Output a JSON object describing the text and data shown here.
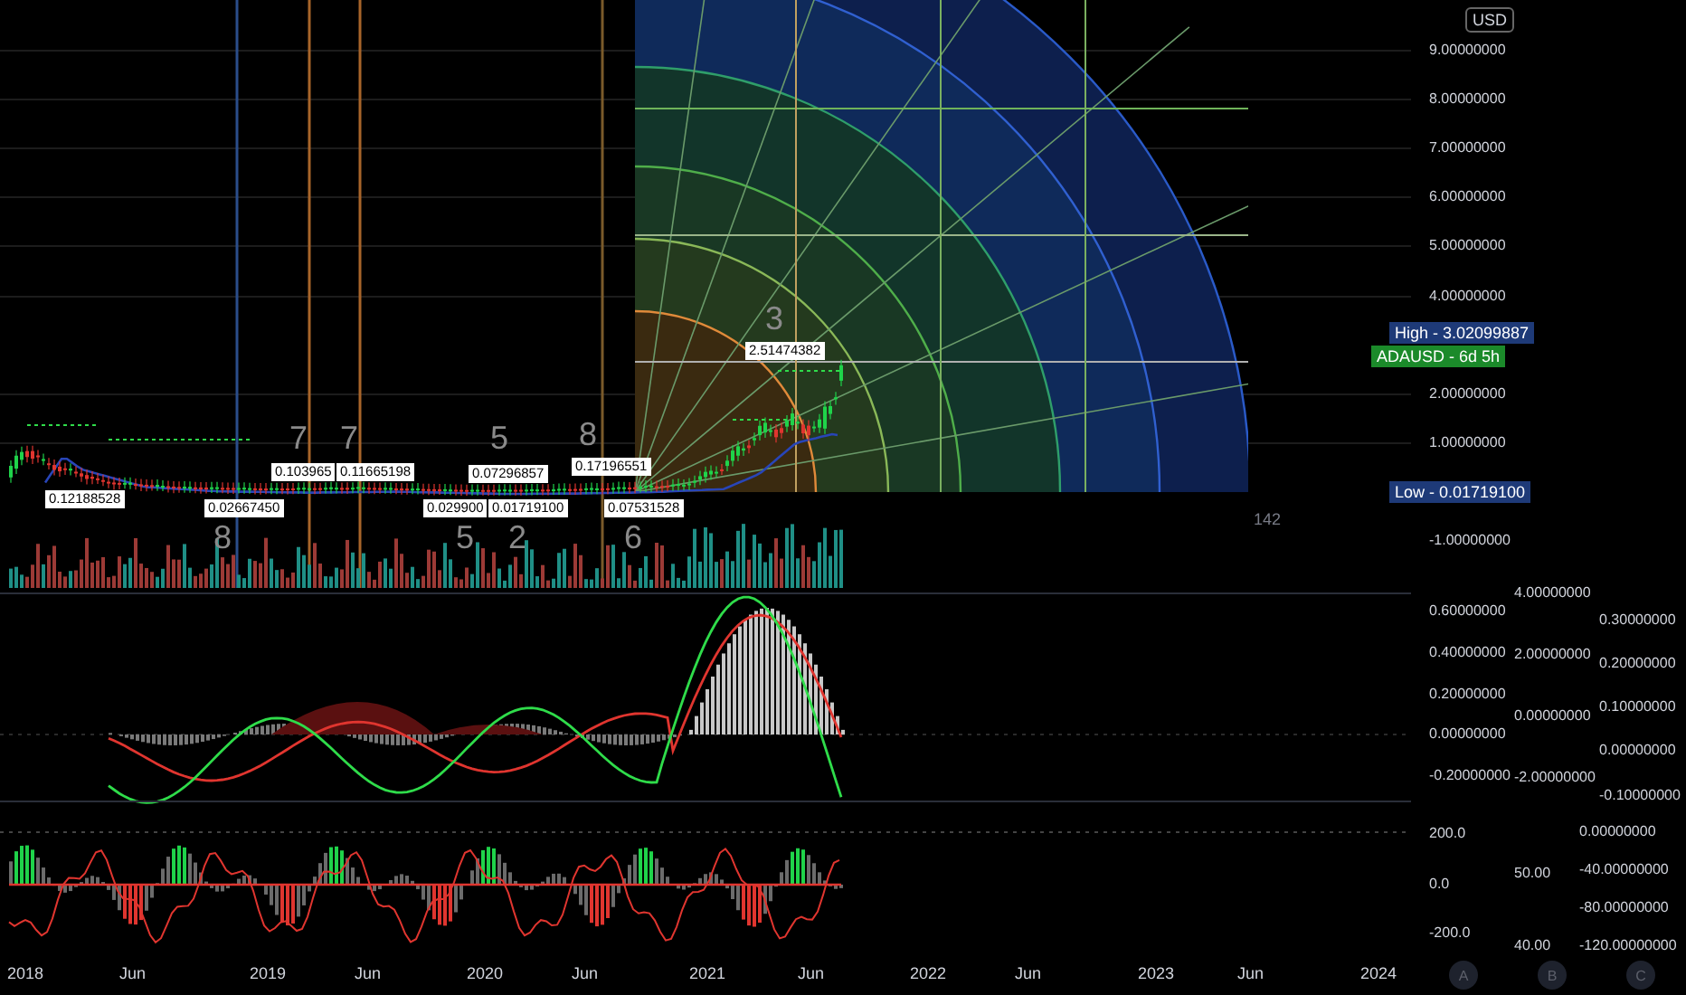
{
  "price_axis": {
    "currency": "USD",
    "labels": [
      "9.00000000",
      "8.00000000",
      "7.00000000",
      "6.00000000",
      "5.00000000",
      "4.00000000",
      "2.00000000",
      "1.00000000",
      "-1.00000000"
    ]
  },
  "price_tags": [
    {
      "kind": "high",
      "text": "High - 3.02099887"
    },
    {
      "kind": "symbol",
      "text": "ADAUSD - 6d 5h"
    },
    {
      "kind": "low",
      "text": "Low - 0.01719100"
    }
  ],
  "bar_count": "142",
  "value_labels": [
    "0.12188528",
    "0.02667450",
    "0.103965",
    "0.11665198",
    "0.07296857",
    "0.029900",
    "0.01719100",
    "0.17196551",
    "0.07531528",
    "2.51474382"
  ],
  "cycle_numbers": [
    "7",
    "7",
    "5",
    "8",
    "3",
    "8",
    "5",
    "2",
    "6"
  ],
  "oscillator_axes": {
    "a": [
      "0.60000000",
      "0.40000000",
      "0.20000000",
      "0.00000000",
      "-0.20000000"
    ],
    "b": [
      "4.00000000",
      "2.00000000",
      "0.00000000",
      "-2.00000000"
    ],
    "c": [
      "0.30000000",
      "0.20000000",
      "0.10000000",
      "0.00000000",
      "-0.10000000"
    ]
  },
  "rsi_axes": {
    "a": [
      "200.0",
      "0.0",
      "-200.0"
    ],
    "b": [
      "50.00",
      "40.00"
    ],
    "c": [
      "0.00000000",
      "-40.00000000",
      "-80.00000000",
      "-120.00000000"
    ]
  },
  "time_axis": [
    "2018",
    "Jun",
    "2019",
    "Jun",
    "2020",
    "Jun",
    "2021",
    "Jun",
    "2022",
    "Jun",
    "2023",
    "Jun",
    "2024"
  ],
  "scale_buttons": [
    "A",
    "B",
    "C"
  ]
}
